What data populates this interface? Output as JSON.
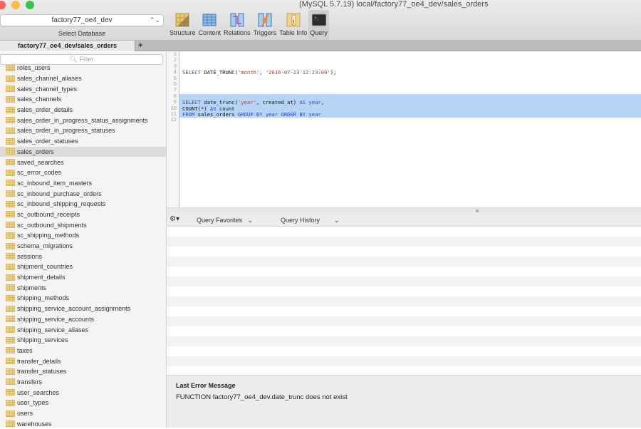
{
  "window": {
    "title": "(MySQL 5.7.19) local/factory77_oe4_dev/sales_orders",
    "traffic_lights": {
      "close": "#fc605c",
      "minimize": "#fdbc40",
      "zoom": "#34c84a"
    }
  },
  "database_selector": {
    "value": "factory77_oe4_dev",
    "label": "Select Database"
  },
  "toolbar": {
    "buttons": [
      {
        "label": "Structure",
        "icon": "structure-icon"
      },
      {
        "label": "Content",
        "icon": "content-icon"
      },
      {
        "label": "Relations",
        "icon": "relations-icon"
      },
      {
        "label": "Triggers",
        "icon": "triggers-icon"
      },
      {
        "label": "Table Info",
        "icon": "table-info-icon"
      },
      {
        "label": "Query",
        "icon": "terminal-icon",
        "active": true
      }
    ]
  },
  "tabs": {
    "active": "factory77_oe4_dev/sales_orders",
    "add": "+"
  },
  "sidebar": {
    "filter_placeholder": "Filter",
    "selected": "sales_orders",
    "tables": [
      "roles_users",
      "sales_channel_aliases",
      "sales_channel_types",
      "sales_channels",
      "sales_order_details",
      "sales_order_in_progress_status_assignments",
      "sales_order_in_progress_statuses",
      "sales_order_statuses",
      "sales_orders",
      "saved_searches",
      "sc_error_codes",
      "sc_inbound_item_masters",
      "sc_inbound_purchase_orders",
      "sc_inbound_shipping_requests",
      "sc_outbound_receipts",
      "sc_outbound_shipments",
      "sc_shipping_methods",
      "schema_migrations",
      "sessions",
      "shipment_countries",
      "shipment_details",
      "shipments",
      "shipping_methods",
      "shipping_service_account_assignments",
      "shipping_service_accounts",
      "shipping_service_aliases",
      "shipping_services",
      "taxes",
      "transfer_details",
      "transfer_statuses",
      "transfers",
      "user_searches",
      "user_types",
      "users",
      "warehouses"
    ]
  },
  "editor": {
    "line_numbers": [
      "1",
      "2",
      "3",
      "4",
      "5",
      "6",
      "7",
      "8",
      "9",
      "10",
      "11",
      "12"
    ],
    "lines": [
      {
        "tokens": [],
        "hl": false
      },
      {
        "tokens": [],
        "hl": false
      },
      {
        "tokens": [],
        "hl": false
      },
      {
        "tokens": [
          {
            "t": "SELECT",
            "c": "kw"
          },
          {
            "t": " DATE_TRUNC(",
            "c": ""
          },
          {
            "t": "'month'",
            "c": "str"
          },
          {
            "t": ", ",
            "c": ""
          },
          {
            "t": "'2016-07-23 12:23:00'",
            "c": "str"
          },
          {
            "t": ");",
            "c": ""
          }
        ],
        "hl": false
      },
      {
        "tokens": [],
        "hl": false
      },
      {
        "tokens": [],
        "hl": false
      },
      {
        "tokens": [],
        "hl": false
      },
      {
        "tokens": [],
        "hl": true
      },
      {
        "tokens": [
          {
            "t": "SELECT",
            "c": "kw"
          },
          {
            "t": " date_trunc(",
            "c": ""
          },
          {
            "t": "'year'",
            "c": "str"
          },
          {
            "t": ", created_at) ",
            "c": ""
          },
          {
            "t": "AS year",
            "c": "kw"
          },
          {
            "t": ",",
            "c": ""
          }
        ],
        "hl": true
      },
      {
        "tokens": [
          {
            "t": "COUNT(*) ",
            "c": ""
          },
          {
            "t": "AS",
            "c": "kw"
          },
          {
            "t": " count",
            "c": ""
          }
        ],
        "hl": true
      },
      {
        "tokens": [
          {
            "t": "FROM",
            "c": "kw"
          },
          {
            "t": " sales_orders ",
            "c": ""
          },
          {
            "t": "GROUP BY year ORDER BY year",
            "c": "kw"
          }
        ],
        "hl": true
      },
      {
        "tokens": [],
        "hl": false
      }
    ]
  },
  "query_bar": {
    "gear": "⚙▾",
    "favorites": "Query Favorites",
    "history": "Query History",
    "chevron": "⌄"
  },
  "error": {
    "title": "Last Error Message",
    "message": "FUNCTION factory77_oe4_dev.date_trunc does not exist"
  }
}
